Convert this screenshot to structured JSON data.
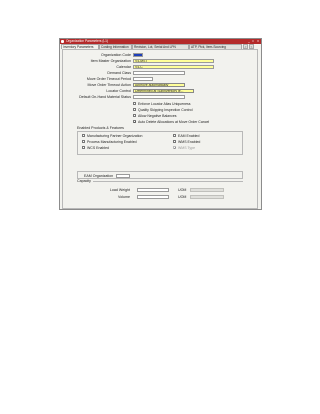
{
  "window": {
    "title": "Organization Parameters (L1)",
    "controls": [
      "_",
      "□",
      "x"
    ]
  },
  "tabs": [
    {
      "label": "Inventory Parameters",
      "active": true
    },
    {
      "label": "Costing Information",
      "active": false
    },
    {
      "label": "Revision, Lot, Serial And LPN",
      "active": false
    },
    {
      "label": "ATP, Pick, Item-Sourcing",
      "active": false
    }
  ],
  "tab_nav": [
    "<",
    ">"
  ],
  "fields": {
    "organization_code": {
      "label": "Organization Code",
      "value": ""
    },
    "item_master_org": {
      "label": "Item Master Organization",
      "value": "V4-MST"
    },
    "calendar": {
      "label": "Calendar",
      "value": "V4-C"
    },
    "demand_class": {
      "label": "Demand Class",
      "value": ""
    },
    "move_order_timeout_period": {
      "label": "Move Order Timeout Period",
      "value": ""
    },
    "move_order_timeout_action": {
      "label": "Move Order Timeout Action",
      "value": "Approve automatically"
    },
    "locator_control": {
      "label": "Locator Control",
      "value": "Determined at Subinventory le..."
    },
    "default_onhand_status": {
      "label": "Default On-Hand Material Status",
      "value": ""
    }
  },
  "checkboxes": [
    {
      "label": "Enforce Locator Alias Uniqueness",
      "checked": false
    },
    {
      "label": "Quality Skipping Inspection Control",
      "checked": false
    },
    {
      "label": "Allow Negative Balances",
      "checked": false
    },
    {
      "label": "Auto Delete Allocations at Move Order Cancel",
      "checked": true
    }
  ],
  "enabled_products": {
    "title": "Enabled Products & Features",
    "items": [
      {
        "label": "Manufacturing Partner Organization",
        "checked": false
      },
      {
        "label": "EAM Enabled",
        "checked": false
      },
      {
        "label": "Process Manufacturing Enabled",
        "checked": false
      },
      {
        "label": "WMS Enabled",
        "checked": false
      },
      {
        "label": "WCS Enabled",
        "checked": false
      },
      {
        "label": "WMS Type",
        "checked": true
      }
    ]
  },
  "eam_org": {
    "label": "EAM Organization",
    "value": ""
  },
  "capacity": {
    "title": "Capacity",
    "load_weight": {
      "label": "Load Weight",
      "value": "",
      "uom_label": "UOM",
      "uom": ""
    },
    "volume": {
      "label": "Volume",
      "value": "",
      "uom_label": "UOM",
      "uom": ""
    }
  },
  "colors": {
    "title_bar": "#b42a2a",
    "required": "#ffff99",
    "selected": "#1e3fb8",
    "panel": "#f2f2ee"
  }
}
